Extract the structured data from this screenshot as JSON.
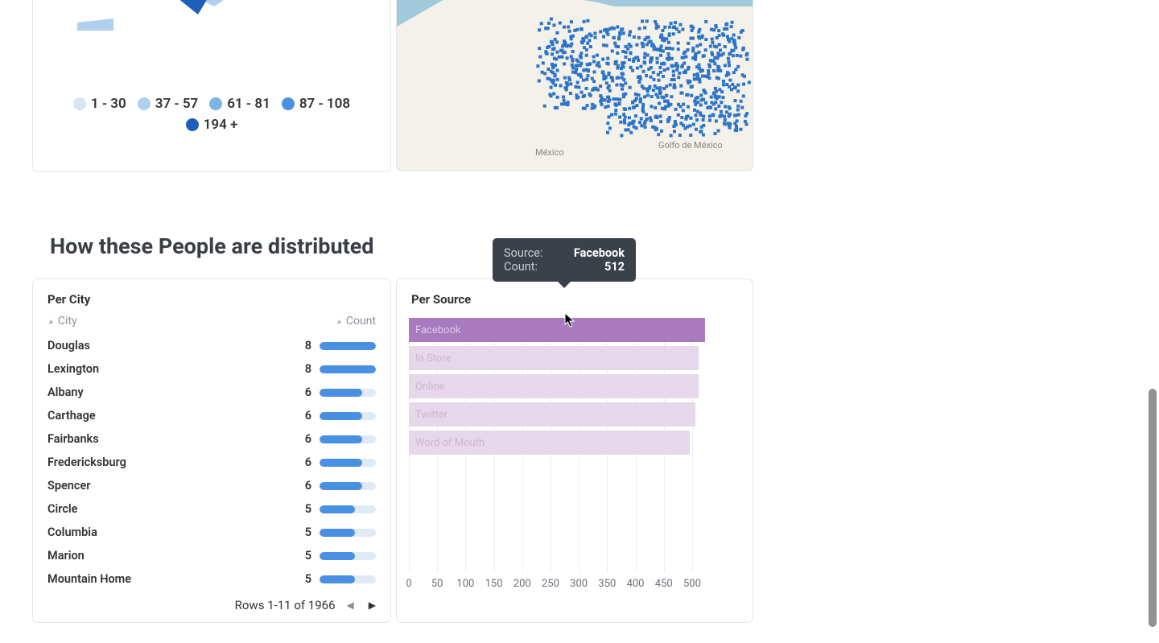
{
  "maps": {
    "legend": [
      {
        "label": "1 - 30",
        "color": "#d6e6f5"
      },
      {
        "label": "37 - 57",
        "color": "#aecfee"
      },
      {
        "label": "61 - 81",
        "color": "#7eb4e4"
      },
      {
        "label": "87 - 108",
        "color": "#4a90e2"
      },
      {
        "label": "194 +",
        "color": "#1f5fb8"
      }
    ],
    "mexico_label": "México",
    "gulf_label": "Golfo de México"
  },
  "section_title": "How these People are distributed",
  "city_card": {
    "title": "Per City",
    "headers": {
      "city": "City",
      "count": "Count"
    },
    "max_count": 8,
    "rows": [
      {
        "city": "Douglas",
        "count": 8
      },
      {
        "city": "Lexington",
        "count": 8
      },
      {
        "city": "Albany",
        "count": 6
      },
      {
        "city": "Carthage",
        "count": 6
      },
      {
        "city": "Fairbanks",
        "count": 6
      },
      {
        "city": "Fredericksburg",
        "count": 6
      },
      {
        "city": "Spencer",
        "count": 6
      },
      {
        "city": "Circle",
        "count": 5
      },
      {
        "city": "Columbia",
        "count": 5
      },
      {
        "city": "Marion",
        "count": 5
      },
      {
        "city": "Mountain Home",
        "count": 5
      }
    ],
    "pager_text": "Rows 1-11 of 1966"
  },
  "source_card": {
    "title": "Per Source"
  },
  "tooltip": {
    "source_label": "Source:",
    "count_label": "Count:",
    "source_value": "Facebook",
    "count_value": "512"
  },
  "chart_data": {
    "type": "bar",
    "orientation": "horizontal",
    "xlabel": "",
    "ylabel": "",
    "xlim": [
      0,
      520
    ],
    "x_ticks": [
      0,
      50,
      100,
      150,
      200,
      250,
      300,
      350,
      400,
      450,
      500
    ],
    "categories": [
      "Facebook",
      "In Store",
      "Online",
      "Twitter",
      "Word of Mouth"
    ],
    "values": [
      512,
      500,
      500,
      495,
      485
    ],
    "highlighted": "Facebook",
    "colors": {
      "bar": "#e6d7ea",
      "bar_active": "#a97abf"
    }
  }
}
